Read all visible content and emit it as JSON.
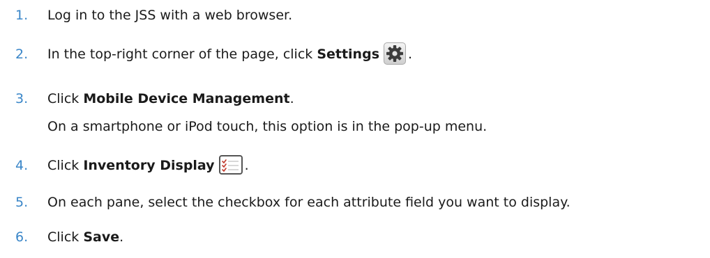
{
  "steps": [
    {
      "num": "1.",
      "pre": "Log in to the JSS with a web browser.",
      "bold": "",
      "post": "",
      "icon": "",
      "note": ""
    },
    {
      "num": "2.",
      "pre": "In the top-right corner of the page, click ",
      "bold": "Settings",
      "post": ".",
      "icon": "gear-icon",
      "note": ""
    },
    {
      "num": "3.",
      "pre": "Click ",
      "bold": "Mobile Device Management",
      "post": ".",
      "icon": "",
      "note": "On a smartphone or iPod touch, this option is in the pop-up menu."
    },
    {
      "num": "4.",
      "pre": "Click ",
      "bold": "Inventory Display",
      "post": ".",
      "icon": "checklist-icon",
      "note": ""
    },
    {
      "num": "5.",
      "pre": "On each pane, select the checkbox for each attribute field you want to display.",
      "bold": "",
      "post": "",
      "icon": "",
      "note": ""
    },
    {
      "num": "6.",
      "pre": "Click ",
      "bold": "Save",
      "post": ".",
      "icon": "",
      "note": ""
    }
  ]
}
